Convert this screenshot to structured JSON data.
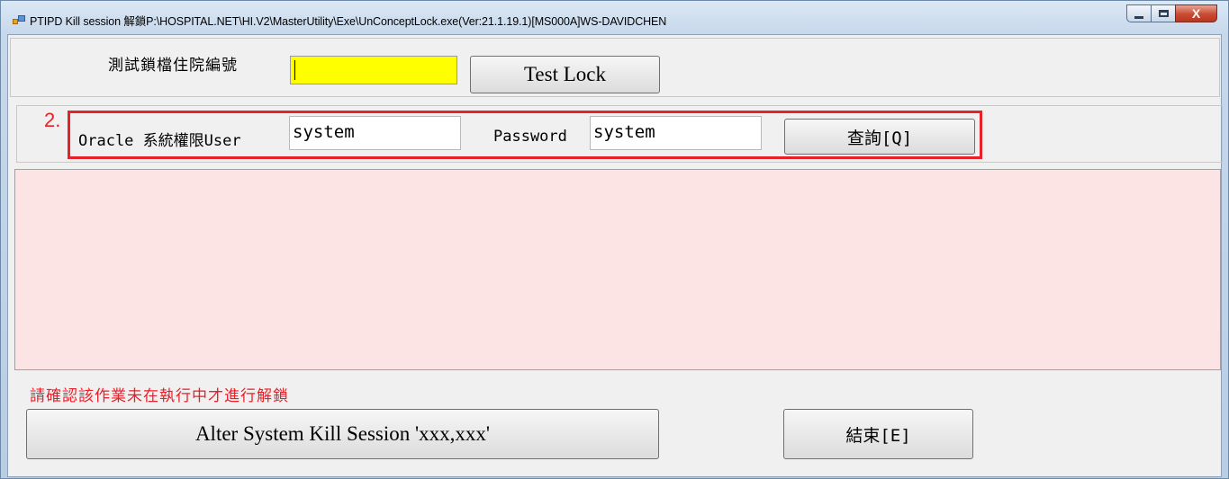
{
  "window": {
    "title": "PTIPD Kill session 解鎖P:\\HOSPITAL.NET\\HI.V2\\MasterUtility\\Exe\\UnConceptLock.exe(Ver:21.1.19.1)[MS000A]WS-DAVIDCHEN",
    "close_label": "X"
  },
  "lock_test": {
    "label": "測試鎖檔住院編號",
    "input_value": "",
    "button_label": "Test Lock",
    "input_color": "#ffff00"
  },
  "oracle": {
    "step_number": "2.",
    "user_label": "Oracle 系統權限User",
    "user_value": "system",
    "password_label": "Password",
    "password_value": "system",
    "query_button_label": "查詢[Q]",
    "highlight_color": "#e8202a"
  },
  "grid": {
    "background_color": "#fde4e4"
  },
  "footer": {
    "warning_text": "請確認該作業未在執行中才進行解鎖",
    "kill_button_label": "Alter System Kill Session 'xxx,xxx'",
    "exit_button_label": "結束[E]"
  }
}
